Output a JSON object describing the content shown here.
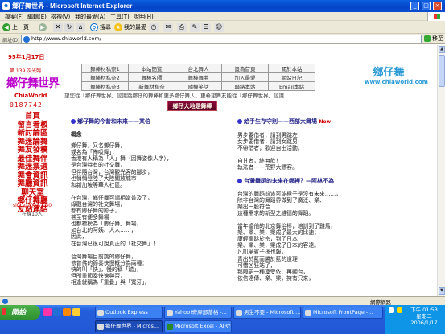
{
  "window": {
    "title": "鄉仔舞世界 - Microsoft Internet Explorer",
    "buttons": [
      "_",
      "□",
      "×"
    ]
  },
  "menu": [
    "檔案(F)",
    "編輯(E)",
    "檢視(V)",
    "我的最愛(A)",
    "工具(T)",
    "說明(H)"
  ],
  "toolbar": {
    "back": "上一頁",
    "search": "搜尋",
    "favorites": "我的最愛"
  },
  "address": {
    "label": "網址(D)",
    "url": "http://www.chiaworld.com/",
    "go": "移至"
  },
  "sidebar": {
    "date": "95年1月17日",
    "issue": "第 139 次光臨",
    "logo": "鄉仔舞世界",
    "logo_en": "ChiaWorld",
    "counter": "0187742",
    "links": [
      "首頁",
      "留言看板",
      "新討論區",
      "舞迷論舞",
      "舞友發稿",
      "最佳舞伴",
      "舞迷票選",
      "舞會資訊",
      "舞廳資訊",
      "聊天室",
      "鄉仔舞廳",
      "友站連結"
    ],
    "since": "since 2002.1.30",
    "online": "在線10人"
  },
  "topnav": {
    "rows": [
      [
        "舞棒材私奈1",
        "本站簡覽",
        "台北舞人",
        "設為首頁",
        "關於本站"
      ],
      [
        "舞棒材私奈2",
        "舞棒名師",
        "舞棒舞曲",
        "加入最愛",
        "網站日記"
      ],
      [
        "舞棒材私奈3",
        "新舞材私奈",
        "隨機笑話",
        "聯絡本站",
        "Email本站"
      ]
    ],
    "brand_cn": "鄉仔舞",
    "brand_en": "www.chiaworld.com"
  },
  "marquee": "望您從「鄉仔舞世界」認識跳鄉仔的舞棒和更多鄉仔舞人，更希望舞友能從「鄉仔舞世界」認識",
  "banner": "鄉仔大地是舞棒",
  "article_left": {
    "heading": "鄉仔舞的今昔和未來——某伯",
    "sub": "概念",
    "para1": [
      "鄉仔舞，又名鄉仔舞，",
      "或名為「佈吸舞」，",
      "香港有人稱為「人」舞（因舞姿像人字），",
      "是台灣特有的社交舞，",
      "但伴隨台灣，台灣觀光客的腳步，",
      "也悄悄登陸了大陸關放城市",
      "和新加坡等華人社區。"
    ],
    "para2": [
      "在台灣，鄉仔舞可謂相當普及了，",
      "綠觀台灣的社交舞場，",
      "都有鄉仔舞的影子，",
      "甚至有便多舞場",
      "也都標榜為「鄉仔舞」舞場，",
      "如台北的阿姨、人人……，",
      "因此，",
      "在台灣已很可說真正的「社交舞」！"
    ],
    "para3": [
      "台灣舞場目前跳的鄉仔舞，",
      "依曾佛的節奏快慢概分為兩種：",
      "快的叫「快」，慢的稱「踏」，",
      "但所重節奏快速與否，",
      "相逢就稱為「重叠」與「寬牙」。"
    ]
  },
  "article_right": {
    "heading": "給手生存守則——西部大舞場",
    "new_badge": "New",
    "para1": [
      "男步要借者，請到男跳左；",
      "女步要借者，請到女跳男；",
      "不帶借者，歡迎自由活動。"
    ],
    "para2": [
      "自甘者，終無飲！",
      "執法者——荒野大鏢客。"
    ],
    "heading2": "台灣舞蹈的未來在哪裡？—阿林不為",
    "para3": [
      "台灣的舞蹈前途可能極子是沒有未來……，",
      "除非台灣的舞蹈界做到了廣泛、樂、",
      "樂出一股符合",
      "這種需求的新型之維德的舞蹈。"
    ],
    "para4": [
      "當年遙他的北京舞治棒，培訓到了雞馬，",
      "樂、樂、樂，樂成了最大的比速；",
      "康輕事跳於宗，到了日本，",
      "樂、樂、樂，樂成了日本的客達。",
      "凡凱吳賓子孫也報，",
      "青出於藍而勝於藍的道理；",
      "可惜凶狂站了，",
      "那隔更一種凜受依、再顯台，",
      "依信達傳、樂、樂，擁有只來，"
    ]
  },
  "statusbar": {
    "zone": "網際網路"
  },
  "taskbar": {
    "start": "開始",
    "tasks_row1": [
      "Outlook Express",
      "Yahoo!奇摩部落格 -...",
      "男生不要 - Microsoft ...",
      "Microsoft FrontPage -..."
    ],
    "tasks_row2": [
      "鄉仔舞世界 - Micros...",
      "Microsoft Excel - AIRY"
    ],
    "time": "下午 01:53",
    "day": "星期二",
    "date": "2006/1/17"
  }
}
